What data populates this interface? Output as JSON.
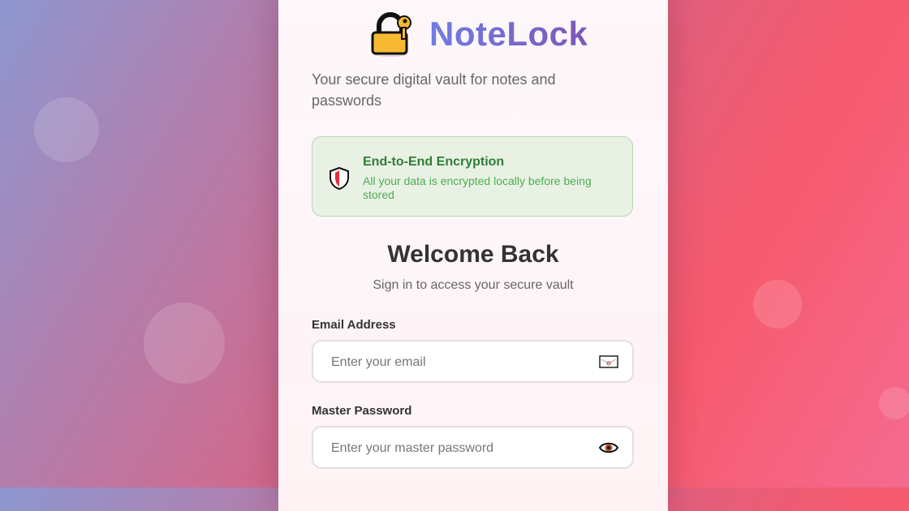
{
  "app": {
    "name": "NoteLock",
    "tagline": "Your secure digital vault for notes and passwords",
    "logo_icon": "lock-key-icon"
  },
  "encryption_notice": {
    "icon": "shield-icon",
    "title": "End-to-End Encryption",
    "description": "All your data is encrypted locally before being stored"
  },
  "login": {
    "title": "Welcome Back",
    "subtitle": "Sign in to access your secure vault",
    "email": {
      "label": "Email Address",
      "placeholder": "Enter your email",
      "value": "",
      "icon": "email-icon"
    },
    "password": {
      "label": "Master Password",
      "placeholder": "Enter your master password",
      "value": "",
      "icon": "eye-icon"
    }
  },
  "colors": {
    "brand_gradient_start": "#6f7de6",
    "brand_gradient_end": "#7d57b8",
    "success_text": "#2f7d36",
    "success_bg": "#e8f1e4",
    "background_pink": "#f75a6d",
    "background_purple": "#8e97d0"
  }
}
